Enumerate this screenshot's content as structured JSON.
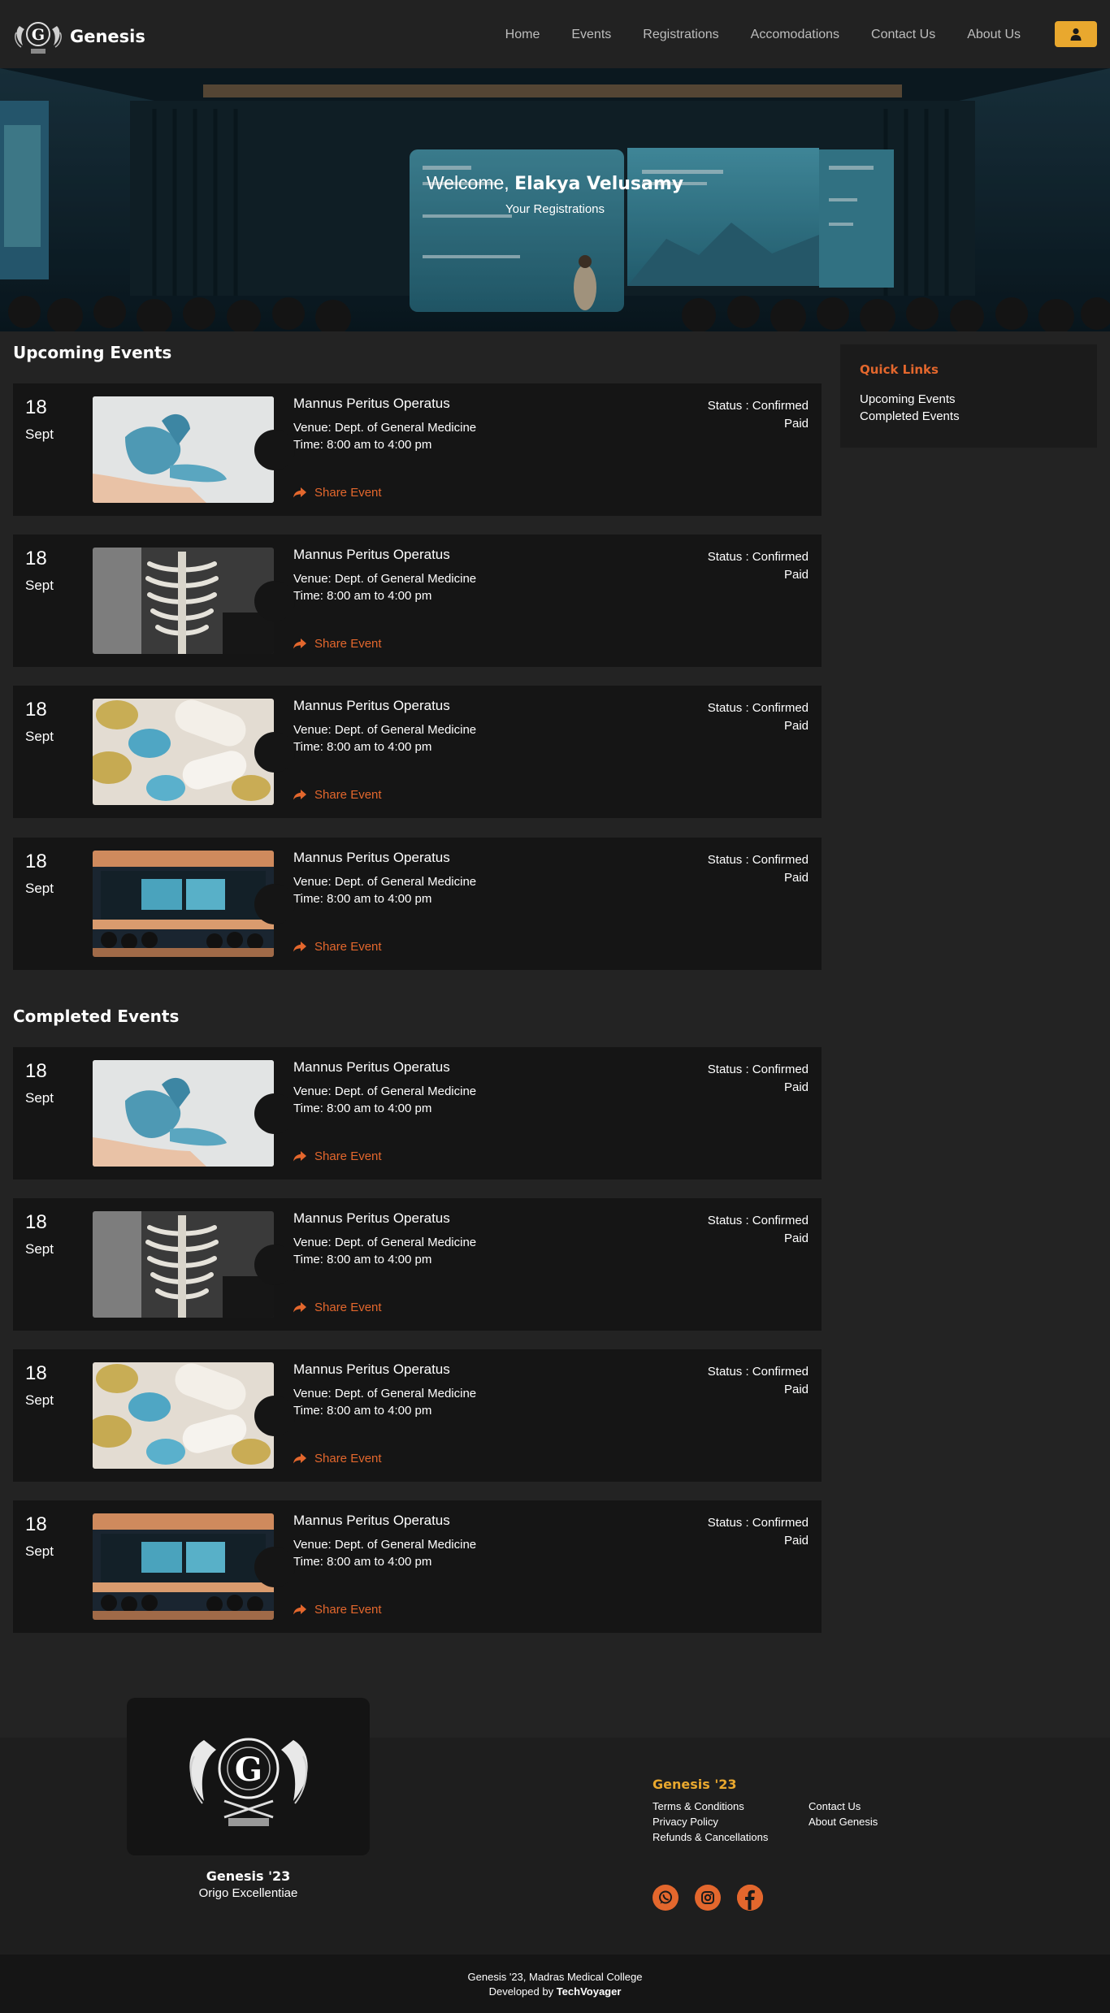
{
  "navbar": {
    "brand": "Genesis",
    "links": [
      "Home",
      "Events",
      "Registrations",
      "Accomodations",
      "Contact Us",
      "About Us"
    ]
  },
  "hero": {
    "welcome_prefix": "Welcome,",
    "user_name": "Elakya Velusamy",
    "subtitle": "Your Registrations"
  },
  "upcoming": {
    "title": "Upcoming Events",
    "events": [
      {
        "day": "18",
        "month": "Sept",
        "title": "Mannus Peritus Operatus",
        "venue": "Venue: Dept. of General Medicine",
        "time": "Time: 8:00 am to 4:00 pm",
        "share": "Share Event",
        "status": "Status : Confirmed",
        "payment": "Paid",
        "image": "gloved-hand"
      },
      {
        "day": "18",
        "month": "Sept",
        "title": "Mannus Peritus Operatus",
        "venue": "Venue: Dept. of General Medicine",
        "time": "Time: 8:00 am to 4:00 pm",
        "share": "Share Event",
        "status": "Status : Confirmed",
        "payment": "Paid",
        "image": "skeleton"
      },
      {
        "day": "18",
        "month": "Sept",
        "title": "Mannus Peritus Operatus",
        "venue": "Venue: Dept. of General Medicine",
        "time": "Time: 8:00 am to 4:00 pm",
        "share": "Share Event",
        "status": "Status : Confirmed",
        "payment": "Paid",
        "image": "pills"
      },
      {
        "day": "18",
        "month": "Sept",
        "title": "Mannus Peritus Operatus",
        "venue": "Venue: Dept. of General Medicine",
        "time": "Time: 8:00 am to 4:00 pm",
        "share": "Share Event",
        "status": "Status : Confirmed",
        "payment": "Paid",
        "image": "auditorium"
      }
    ]
  },
  "completed": {
    "title": "Completed Events",
    "events": [
      {
        "day": "18",
        "month": "Sept",
        "title": "Mannus Peritus Operatus",
        "venue": "Venue: Dept. of General Medicine",
        "time": "Time: 8:00 am to 4:00 pm",
        "share": "Share Event",
        "status": "Status : Confirmed",
        "payment": "Paid",
        "image": "gloved-hand"
      },
      {
        "day": "18",
        "month": "Sept",
        "title": "Mannus Peritus Operatus",
        "venue": "Venue: Dept. of General Medicine",
        "time": "Time: 8:00 am to 4:00 pm",
        "share": "Share Event",
        "status": "Status : Confirmed",
        "payment": "Paid",
        "image": "skeleton"
      },
      {
        "day": "18",
        "month": "Sept",
        "title": "Mannus Peritus Operatus",
        "venue": "Venue: Dept. of General Medicine",
        "time": "Time: 8:00 am to 4:00 pm",
        "share": "Share Event",
        "status": "Status : Confirmed",
        "payment": "Paid",
        "image": "pills"
      },
      {
        "day": "18",
        "month": "Sept",
        "title": "Mannus Peritus Operatus",
        "venue": "Venue: Dept. of General Medicine",
        "time": "Time: 8:00 am to 4:00 pm",
        "share": "Share Event",
        "status": "Status : Confirmed",
        "payment": "Paid",
        "image": "auditorium"
      }
    ]
  },
  "quick_links": {
    "title": "Quick Links",
    "items": [
      "Upcoming Events",
      "Completed Events"
    ]
  },
  "footer": {
    "org": "Genesis '23",
    "motto": "Origo Excellentiae",
    "col_title": "Genesis '23",
    "links_left": [
      "Terms & Conditions",
      "Privacy Policy",
      "Refunds & Cancellations"
    ],
    "links_right": [
      "Contact Us",
      "About Genesis"
    ],
    "social": [
      "whatsapp-icon",
      "instagram-icon",
      "facebook-icon"
    ],
    "copyright": "Genesis '23, Madras Medical College",
    "developed_prefix": "Developed by",
    "developer": "TechVoyager"
  },
  "colors": {
    "accent": "#e3672d",
    "gold": "#e9a82e",
    "background": "#232323",
    "card": "#151515"
  }
}
